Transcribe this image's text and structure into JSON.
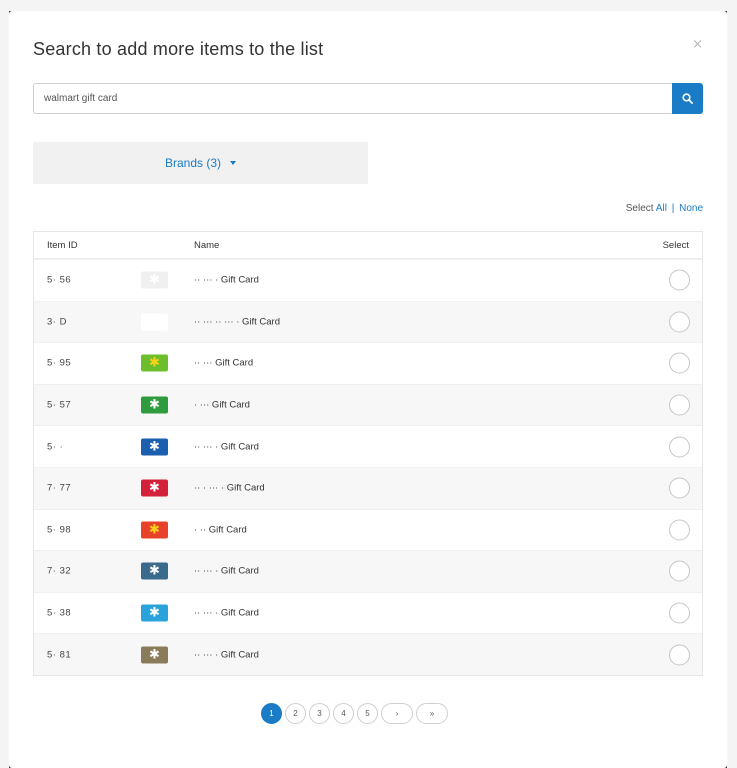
{
  "modal": {
    "title": "Search to add more items to the list",
    "close_glyph": "×"
  },
  "search": {
    "value": "walmart gift card",
    "button_icon": "search-icon"
  },
  "filters": {
    "brands_label": "Brands (3)"
  },
  "select_links": {
    "prefix": "Select",
    "all": "All",
    "separator": "|",
    "none": "None"
  },
  "table": {
    "headers": {
      "item_id": "Item ID",
      "name": "Name",
      "select": "Select"
    },
    "rows": [
      {
        "id": "5·    56",
        "name": "··   ···  ·  Gift Card",
        "thumb_color": "#f0f0f0",
        "thumb_icon": "collage-thumb"
      },
      {
        "id": "3·    D",
        "name": "··  ···  ··  ···  ·  Gift Card",
        "thumb_color": "#ffffff",
        "thumb_icon": "flag-thumb"
      },
      {
        "id": "5·    95",
        "name": "··  ···  Gift Card",
        "thumb_color": "#6cbf2a",
        "thumb_icon": "spark-thumb"
      },
      {
        "id": "5·    57",
        "name": "·  ···  Gift Card",
        "thumb_color": "#2e9c3e",
        "thumb_icon": "green-thumb"
      },
      {
        "id": "5·    ·",
        "name": "··  ···  ·  Gift Card",
        "thumb_color": "#1b5fae",
        "thumb_icon": "yellow-thumb"
      },
      {
        "id": "7·    77",
        "name": "··  ·  ···  ·  Gift Card",
        "thumb_color": "#d4213b",
        "thumb_icon": "red-thumb"
      },
      {
        "id": "5·    98",
        "name": "·  ··  Gift Card",
        "thumb_color": "#e8432a",
        "thumb_icon": "spark-thumb"
      },
      {
        "id": "7·    32",
        "name": "··  ···  ·  Gift Card",
        "thumb_color": "#3a6a8c",
        "thumb_icon": "photo-thumb"
      },
      {
        "id": "5·    38",
        "name": "··  ···  ·  Gift Card",
        "thumb_color": "#29a3d9",
        "thumb_icon": "teal-thumb"
      },
      {
        "id": "5·    81",
        "name": "··  ···  ·  Gift Card",
        "thumb_color": "#8a7c5a",
        "thumb_icon": "photo-thumb"
      }
    ]
  },
  "pagination": {
    "pages": [
      "1",
      "2",
      "3",
      "4",
      "5"
    ],
    "next": "›",
    "last": "»",
    "active": "1"
  },
  "colors": {
    "accent": "#1a7bc6",
    "backdrop": "#2b2b2b"
  }
}
